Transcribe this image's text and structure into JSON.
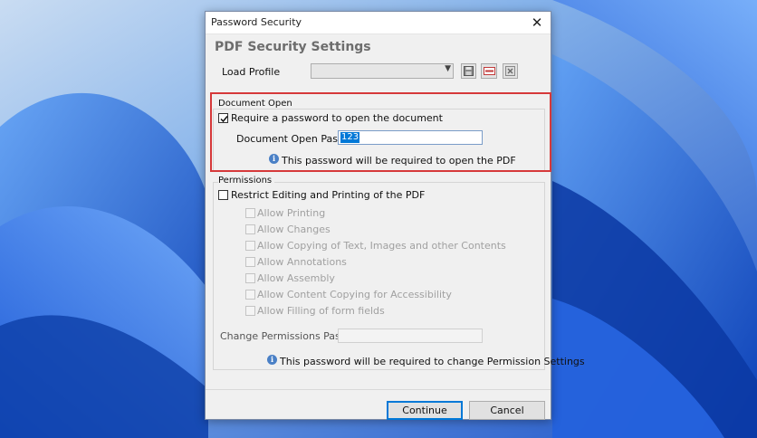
{
  "window": {
    "title": "Password Security",
    "close_glyph": "✕"
  },
  "heading": "PDF Security Settings",
  "profile": {
    "label": "Load Profile",
    "value": "",
    "icons": [
      "save-icon",
      "rename-icon",
      "delete-icon"
    ]
  },
  "document_open": {
    "group_title": "Document Open",
    "require_label": "Require a password to open the document",
    "require_checked": true,
    "password_label": "Document Open Password:",
    "password_value": "123",
    "info_text": "This password will be required to open the PDF"
  },
  "permissions": {
    "group_title": "Permissions",
    "restrict_label": "Restrict Editing and Printing of the PDF",
    "restrict_checked": false,
    "options": [
      "Allow Printing",
      "Allow Changes",
      "Allow Copying of Text, Images and other Contents",
      "Allow Annotations",
      "Allow Assembly",
      "Allow Content Copying for Accessibility",
      "Allow Filling of form fields"
    ],
    "change_password_label": "Change Permissions Password:",
    "change_password_value": "",
    "info_text": "This password will be required to change Permission Settings"
  },
  "buttons": {
    "continue": "Continue",
    "cancel": "Cancel"
  },
  "colors": {
    "highlight": "#d6393a",
    "accent": "#0078d7"
  }
}
